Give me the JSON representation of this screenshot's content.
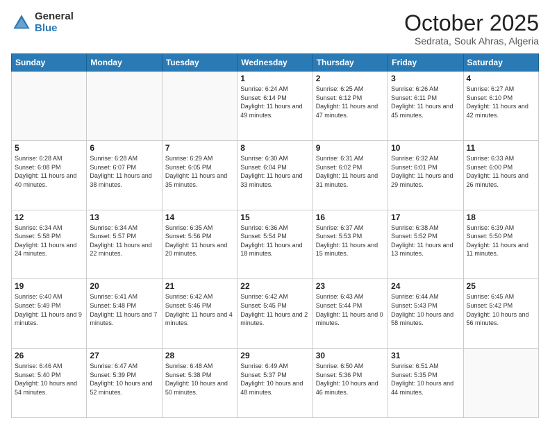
{
  "header": {
    "logo_general": "General",
    "logo_blue": "Blue",
    "month": "October 2025",
    "location": "Sedrata, Souk Ahras, Algeria"
  },
  "days_of_week": [
    "Sunday",
    "Monday",
    "Tuesday",
    "Wednesday",
    "Thursday",
    "Friday",
    "Saturday"
  ],
  "weeks": [
    [
      {
        "day": "",
        "info": ""
      },
      {
        "day": "",
        "info": ""
      },
      {
        "day": "",
        "info": ""
      },
      {
        "day": "1",
        "info": "Sunrise: 6:24 AM\nSunset: 6:14 PM\nDaylight: 11 hours and 49 minutes."
      },
      {
        "day": "2",
        "info": "Sunrise: 6:25 AM\nSunset: 6:12 PM\nDaylight: 11 hours and 47 minutes."
      },
      {
        "day": "3",
        "info": "Sunrise: 6:26 AM\nSunset: 6:11 PM\nDaylight: 11 hours and 45 minutes."
      },
      {
        "day": "4",
        "info": "Sunrise: 6:27 AM\nSunset: 6:10 PM\nDaylight: 11 hours and 42 minutes."
      }
    ],
    [
      {
        "day": "5",
        "info": "Sunrise: 6:28 AM\nSunset: 6:08 PM\nDaylight: 11 hours and 40 minutes."
      },
      {
        "day": "6",
        "info": "Sunrise: 6:28 AM\nSunset: 6:07 PM\nDaylight: 11 hours and 38 minutes."
      },
      {
        "day": "7",
        "info": "Sunrise: 6:29 AM\nSunset: 6:05 PM\nDaylight: 11 hours and 35 minutes."
      },
      {
        "day": "8",
        "info": "Sunrise: 6:30 AM\nSunset: 6:04 PM\nDaylight: 11 hours and 33 minutes."
      },
      {
        "day": "9",
        "info": "Sunrise: 6:31 AM\nSunset: 6:02 PM\nDaylight: 11 hours and 31 minutes."
      },
      {
        "day": "10",
        "info": "Sunrise: 6:32 AM\nSunset: 6:01 PM\nDaylight: 11 hours and 29 minutes."
      },
      {
        "day": "11",
        "info": "Sunrise: 6:33 AM\nSunset: 6:00 PM\nDaylight: 11 hours and 26 minutes."
      }
    ],
    [
      {
        "day": "12",
        "info": "Sunrise: 6:34 AM\nSunset: 5:58 PM\nDaylight: 11 hours and 24 minutes."
      },
      {
        "day": "13",
        "info": "Sunrise: 6:34 AM\nSunset: 5:57 PM\nDaylight: 11 hours and 22 minutes."
      },
      {
        "day": "14",
        "info": "Sunrise: 6:35 AM\nSunset: 5:56 PM\nDaylight: 11 hours and 20 minutes."
      },
      {
        "day": "15",
        "info": "Sunrise: 6:36 AM\nSunset: 5:54 PM\nDaylight: 11 hours and 18 minutes."
      },
      {
        "day": "16",
        "info": "Sunrise: 6:37 AM\nSunset: 5:53 PM\nDaylight: 11 hours and 15 minutes."
      },
      {
        "day": "17",
        "info": "Sunrise: 6:38 AM\nSunset: 5:52 PM\nDaylight: 11 hours and 13 minutes."
      },
      {
        "day": "18",
        "info": "Sunrise: 6:39 AM\nSunset: 5:50 PM\nDaylight: 11 hours and 11 minutes."
      }
    ],
    [
      {
        "day": "19",
        "info": "Sunrise: 6:40 AM\nSunset: 5:49 PM\nDaylight: 11 hours and 9 minutes."
      },
      {
        "day": "20",
        "info": "Sunrise: 6:41 AM\nSunset: 5:48 PM\nDaylight: 11 hours and 7 minutes."
      },
      {
        "day": "21",
        "info": "Sunrise: 6:42 AM\nSunset: 5:46 PM\nDaylight: 11 hours and 4 minutes."
      },
      {
        "day": "22",
        "info": "Sunrise: 6:42 AM\nSunset: 5:45 PM\nDaylight: 11 hours and 2 minutes."
      },
      {
        "day": "23",
        "info": "Sunrise: 6:43 AM\nSunset: 5:44 PM\nDaylight: 11 hours and 0 minutes."
      },
      {
        "day": "24",
        "info": "Sunrise: 6:44 AM\nSunset: 5:43 PM\nDaylight: 10 hours and 58 minutes."
      },
      {
        "day": "25",
        "info": "Sunrise: 6:45 AM\nSunset: 5:42 PM\nDaylight: 10 hours and 56 minutes."
      }
    ],
    [
      {
        "day": "26",
        "info": "Sunrise: 6:46 AM\nSunset: 5:40 PM\nDaylight: 10 hours and 54 minutes."
      },
      {
        "day": "27",
        "info": "Sunrise: 6:47 AM\nSunset: 5:39 PM\nDaylight: 10 hours and 52 minutes."
      },
      {
        "day": "28",
        "info": "Sunrise: 6:48 AM\nSunset: 5:38 PM\nDaylight: 10 hours and 50 minutes."
      },
      {
        "day": "29",
        "info": "Sunrise: 6:49 AM\nSunset: 5:37 PM\nDaylight: 10 hours and 48 minutes."
      },
      {
        "day": "30",
        "info": "Sunrise: 6:50 AM\nSunset: 5:36 PM\nDaylight: 10 hours and 46 minutes."
      },
      {
        "day": "31",
        "info": "Sunrise: 6:51 AM\nSunset: 5:35 PM\nDaylight: 10 hours and 44 minutes."
      },
      {
        "day": "",
        "info": ""
      }
    ]
  ]
}
